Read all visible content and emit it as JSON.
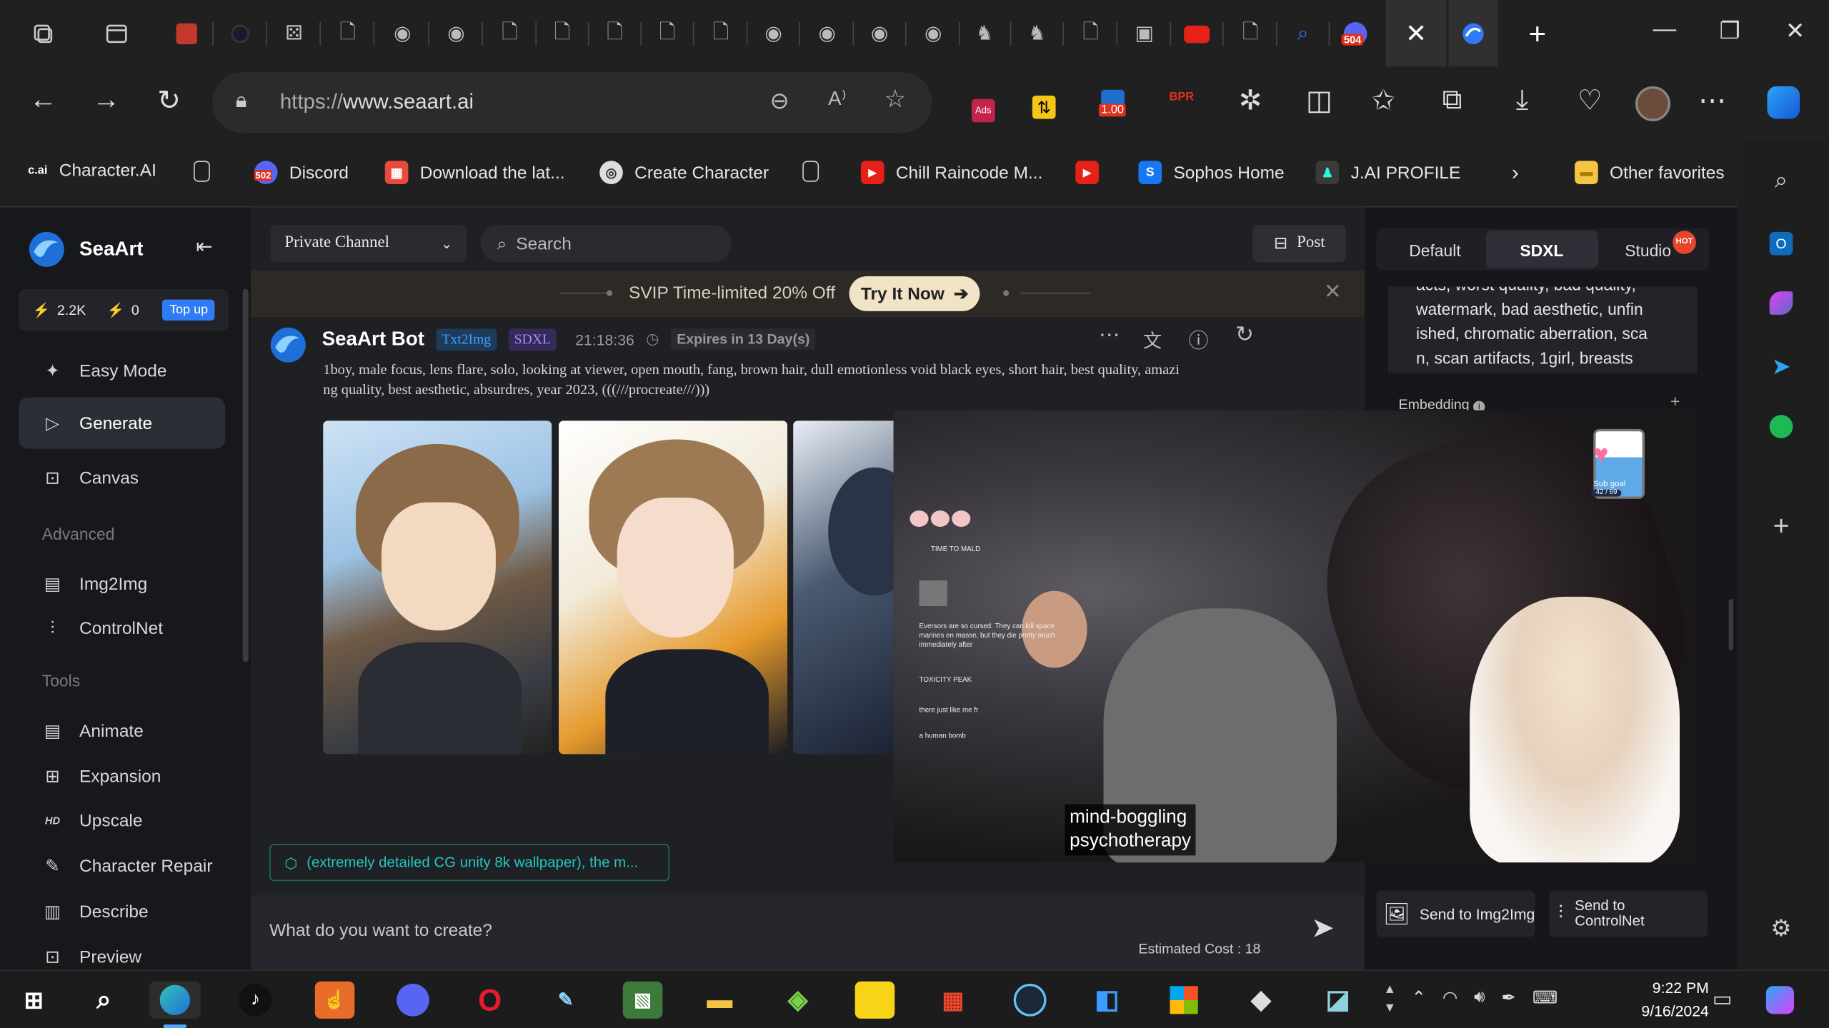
{
  "browser": {
    "url_prefix": "https://",
    "url_domain": "www.seaart.ai",
    "ext_badge_1": "1.00",
    "ext_badge_2": "504"
  },
  "bookmarks": [
    {
      "label": "Character.AI",
      "icon": "c.ai"
    },
    {
      "label": "",
      "icon": "page-icon"
    },
    {
      "label": "Discord",
      "icon": "502"
    },
    {
      "label": "Download the lat...",
      "icon": "download-icon"
    },
    {
      "label": "Create Character",
      "icon": "create-icon"
    },
    {
      "label": "",
      "icon": "page-icon"
    },
    {
      "label": "Chill Raincode M...",
      "icon": "youtube-icon"
    },
    {
      "label": "",
      "icon": "youtube-icon"
    },
    {
      "label": "Sophos Home",
      "icon": "S"
    },
    {
      "label": "J.AI PROFILE",
      "icon": "jai-icon"
    },
    {
      "label": "Other favorites",
      "icon": "folder-icon"
    }
  ],
  "sidebar": {
    "brand": "SeaArt",
    "stats": {
      "energy": "2.2K",
      "bolt": "0",
      "topup": "Top up"
    },
    "items": [
      {
        "label": "Easy Mode",
        "icon": "sparkle-icon"
      },
      {
        "label": "Generate",
        "icon": "play-icon"
      },
      {
        "label": "Canvas",
        "icon": "canvas-icon"
      }
    ],
    "advanced_heading": "Advanced",
    "advanced": [
      {
        "label": "Img2Img",
        "icon": "img2img-icon"
      },
      {
        "label": "ControlNet",
        "icon": "sliders-icon"
      }
    ],
    "tools_heading": "Tools",
    "tools": [
      {
        "label": "Animate",
        "icon": "animate-icon"
      },
      {
        "label": "Expansion",
        "icon": "expansion-icon"
      },
      {
        "label": "Upscale",
        "icon": "hd-icon"
      },
      {
        "label": "Character Repair",
        "icon": "repair-icon"
      },
      {
        "label": "Describe",
        "icon": "describe-icon"
      },
      {
        "label": "Preview",
        "icon": "preview-icon"
      }
    ]
  },
  "main": {
    "channel": "Private Channel",
    "search_placeholder": "Search",
    "post": "Post",
    "promo_text": "SVIP Time-limited 20% Off",
    "promo_button": "Try It Now",
    "bot_name": "SeaArt Bot",
    "tag1": "Txt2Img",
    "tag2": "SDXL",
    "time": "21:18:36",
    "expires": "Expires in 13 Day(s)",
    "prompt_line1": "1boy, male focus, lens flare, solo, looking at viewer, open mouth, fang, brown hair, dull emotionless void black eyes, short hair, best quality, amazi",
    "prompt_line2": "ng quality, best aesthetic, absurdres, year 2023, (((///procreate///)))",
    "suggestion": "(extremely detailed CG unity 8k wallpaper), the m...",
    "input_placeholder": "What do you want to create?",
    "cost": "Estimated Cost : 18"
  },
  "rightpanel": {
    "tabs": [
      "Default",
      "SDXL",
      "Studio"
    ],
    "hot": "HOT",
    "neg_lines": [
      "acts, worst quality, bad quality,",
      "watermark, bad aesthetic, unfin",
      "ished, chromatic aberration, sca",
      "n, scan artifacts, 1girl, breasts"
    ],
    "embedding": "Embedding",
    "send_img2img": "Send to Img2Img",
    "send_controlnet_1": "Send to",
    "send_controlnet_2": "ControlNet"
  },
  "video": {
    "caption_1": "mind-boggling",
    "caption_2": "psychotherapy",
    "chat_1": "TIME TO MALD",
    "chat_2": "Eversors are so cursed. They can kill space marines en masse, but they die pretty much immediately after",
    "chat_3": "TOXICITY PEAK",
    "chat_4": "there just like me fr",
    "chat_5": "a human bomb",
    "goal_label": "Sub goal",
    "goal_count": "42 / 69"
  },
  "taskbar": {
    "time": "9:22 PM",
    "date": "9/16/2024"
  },
  "colors": {
    "accent_blue": "#2f7bf5",
    "promo_bg": "#2d2a26",
    "cyan": "#21c8c0"
  }
}
